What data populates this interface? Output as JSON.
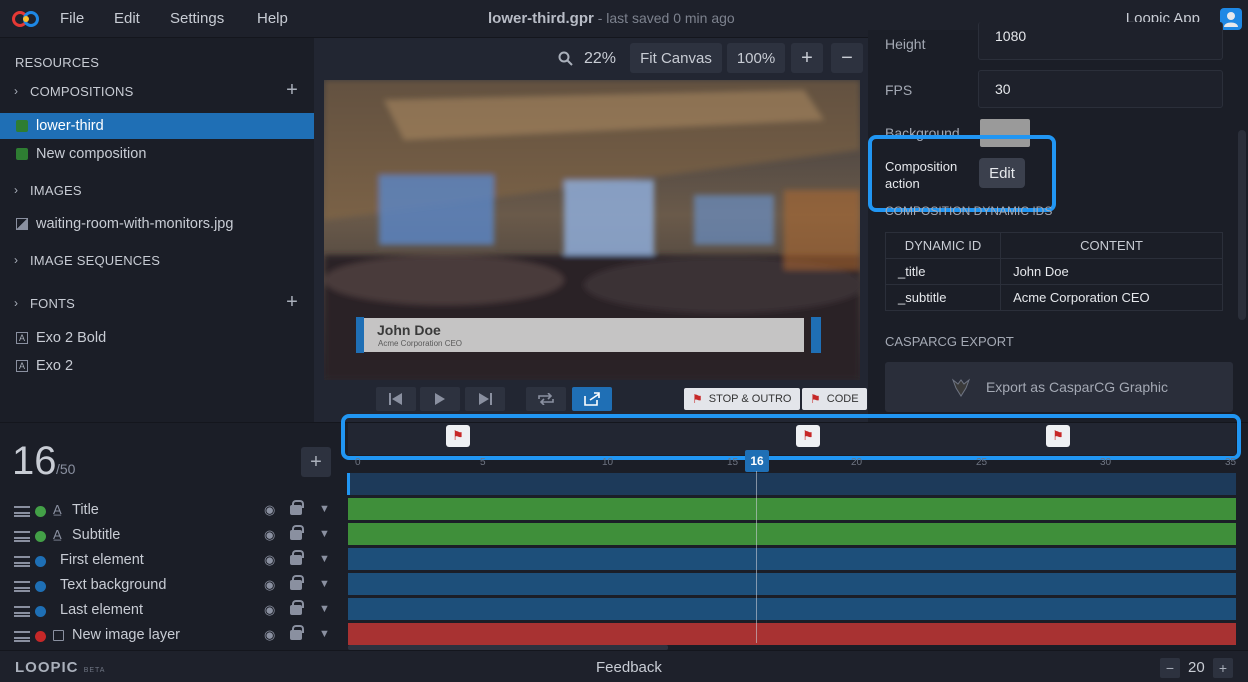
{
  "menu": [
    "File",
    "Edit",
    "Settings",
    "Help"
  ],
  "window": {
    "file_name": "lower-third.gpr",
    "saved_status": " - last saved 0 min ago",
    "app_name": "Loopic App"
  },
  "resources": {
    "title": "RESOURCES",
    "compositions_label": "COMPOSITIONS",
    "compositions": [
      "lower-third",
      "New composition"
    ],
    "images_label": "IMAGES",
    "images": [
      "waiting-room-with-monitors.jpg"
    ],
    "image_sequences_label": "IMAGE SEQUENCES",
    "fonts_label": "FONTS",
    "fonts": [
      "Exo 2 Bold",
      "Exo 2"
    ]
  },
  "preview": {
    "zoom_level": "22%",
    "fit_canvas": "Fit Canvas",
    "zoom_100": "100%",
    "lower_third_name": "John Doe",
    "lower_third_title": "Acme Corporation CEO",
    "stop_outro": "STOP & OUTRO",
    "code": "CODE"
  },
  "properties": {
    "height_label": "Height",
    "height_value": "1080",
    "fps_label": "FPS",
    "fps_value": "30",
    "background_label": "Background",
    "background_color": "#9a9a9a",
    "composition_action_label": "Composition action",
    "edit_button": "Edit",
    "dynamic_ids_heading": "COMPOSITION DYNAMIC IDS",
    "dynamic_table": {
      "headers": [
        "DYNAMIC ID",
        "CONTENT"
      ],
      "rows": [
        [
          "_title",
          "John Doe"
        ],
        [
          "_subtitle",
          "Acme Corporation CEO"
        ]
      ]
    },
    "casparcg_heading": "CASPARCG EXPORT",
    "export_button": "Export as CasparCG Graphic"
  },
  "timeline": {
    "current_frame": "16",
    "total_frames": "/50",
    "playhead_frame": "16",
    "ruler": [
      "0",
      "5",
      "10",
      "15",
      "20",
      "25",
      "30",
      "35"
    ],
    "layers": [
      {
        "name": "Title",
        "color": "#43a047",
        "type": "text"
      },
      {
        "name": "Subtitle",
        "color": "#43a047",
        "type": "text"
      },
      {
        "name": "First element",
        "color": "#1e6fb5",
        "type": "shape"
      },
      {
        "name": "Text background",
        "color": "#1e6fb5",
        "type": "shape"
      },
      {
        "name": "Last element",
        "color": "#1e6fb5",
        "type": "shape"
      },
      {
        "name": "New image layer",
        "color": "#c62828",
        "type": "image"
      }
    ]
  },
  "statusbar": {
    "logo": "LOOPIC",
    "logo_beta": "BETA",
    "feedback": "Feedback",
    "zoom_value": "20"
  },
  "colors": {
    "accent": "#1f6fb5",
    "highlight": "#2196f3",
    "text_track": "#3f8f3a",
    "shape_track": "#1d4f7a",
    "image_track": "#a83232"
  }
}
